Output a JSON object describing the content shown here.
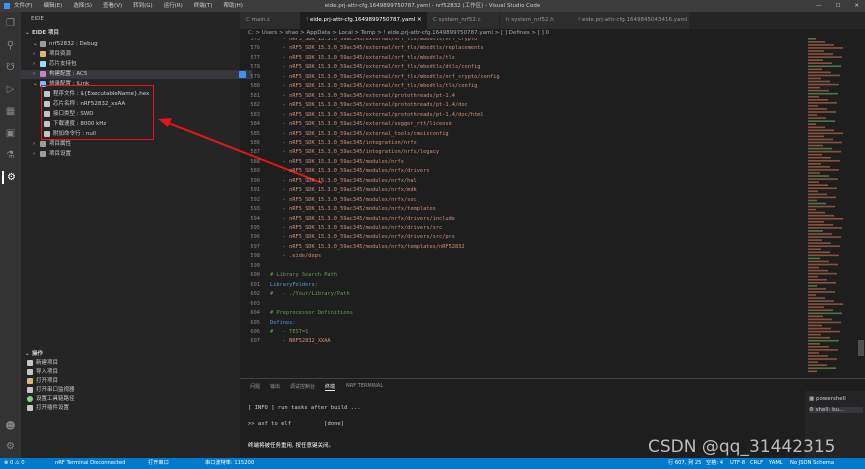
{
  "titlebar": {
    "menus": [
      "文件(F)",
      "编辑(E)",
      "选择(S)",
      "查看(V)",
      "转到(G)",
      "运行(R)",
      "终端(T)",
      "帮助(H)"
    ],
    "title": "eide.prj-attr-cfg.1649899750787.yaml - nrf52832 (工作区) - Visual Studio Code"
  },
  "sidebar": {
    "header": "EIDE",
    "section": "EIDE 项目",
    "project": "nrf52832 : Debug",
    "items": [
      "项目资源",
      "芯片支持包",
      "构建配置 : AC5",
      "烧录配置 : JLink"
    ],
    "flash": [
      "程序文件 : ${ExecutableName}.hex",
      "芯片名称 : nRF52832_xxAA",
      "接口类型 : SWD",
      "下载速度 : 8000 kHz",
      "附加命令行 : null"
    ],
    "after": [
      "项目属性",
      "项目设置"
    ],
    "ops_header": "操作",
    "ops": [
      "新建项目",
      "导入项目",
      "打开项目",
      "打开串口监视器",
      "设置工具链路径",
      "打开插件设置"
    ]
  },
  "tabs": [
    "main.c",
    "eide.prj-attr-cfg.1649899750787.yaml",
    "system_nrf52.c",
    "system_nrf52.h",
    "eide.prj-attr-cfg.1649845043416.yaml"
  ],
  "breadcrumb": "C: > Users > shao > AppData > Local > Temp > ! eide.prj-attr-cfg.1649899750787.yaml > [ ] Defines > [ ] 0",
  "code": [
    {
      "n": "575",
      "t": "    - nRF5_SDK_15.3.0_59ac345/external/nrf_tls/mbedtls/nrf_crypto"
    },
    {
      "n": "576",
      "t": "    - nRF5_SDK_15.3.0_59ac345/external/nrf_tls/mbedtls/replacements"
    },
    {
      "n": "577",
      "t": "    - nRF5_SDK_15.3.0_59ac345/external/nrf_tls/mbedtls/tls"
    },
    {
      "n": "578",
      "t": "    - nRF5_SDK_15.3.0_59ac345/external/nrf_tls/mbedtls/dtls/config"
    },
    {
      "n": "579",
      "t": "    - nRF5_SDK_15.3.0_59ac345/external/nrf_tls/mbedtls/nrf_crypto/config"
    },
    {
      "n": "580",
      "t": "    - nRF5_SDK_15.3.0_59ac345/external/nrf_tls/mbedtls/tls/config"
    },
    {
      "n": "581",
      "t": "    - nRF5_SDK_15.3.0_59ac345/external/protothreads/pt-1.4"
    },
    {
      "n": "582",
      "t": "    - nRF5_SDK_15.3.0_59ac345/external/protothreads/pt-1.4/doc"
    },
    {
      "n": "583",
      "t": "    - nRF5_SDK_15.3.0_59ac345/external/protothreads/pt-1.4/doc/html"
    },
    {
      "n": "584",
      "t": "    - nRF5_SDK_15.3.0_59ac345/external/segger_rtt/license"
    },
    {
      "n": "585",
      "t": "    - nRF5_SDK_15.3.0_59ac345/external_tools/cmsisconfig"
    },
    {
      "n": "586",
      "t": "    - nRF5_SDK_15.3.0_59ac345/integration/nrfx"
    },
    {
      "n": "587",
      "t": "    - nRF5_SDK_15.3.0_59ac345/integration/nrfx/legacy"
    },
    {
      "n": "588",
      "t": "    - nRF5_SDK_15.3.0_59ac345/modules/nrfx"
    },
    {
      "n": "589",
      "t": "    - nRF5_SDK_15.3.0_59ac345/modules/nrfx/drivers"
    },
    {
      "n": "590",
      "t": "    - nRF5_SDK_15.3.0_59ac345/modules/nrfx/hal"
    },
    {
      "n": "591",
      "t": "    - nRF5_SDK_15.3.0_59ac345/modules/nrfx/mdk"
    },
    {
      "n": "592",
      "t": "    - nRF5_SDK_15.3.0_59ac345/modules/nrfx/soc"
    },
    {
      "n": "593",
      "t": "    - nRF5_SDK_15.3.0_59ac345/modules/nrfx/templates"
    },
    {
      "n": "594",
      "t": "    - nRF5_SDK_15.3.0_59ac345/modules/nrfx/drivers/include"
    },
    {
      "n": "595",
      "t": "    - nRF5_SDK_15.3.0_59ac345/modules/nrfx/drivers/src"
    },
    {
      "n": "596",
      "t": "    - nRF5_SDK_15.3.0_59ac345/modules/nrfx/drivers/src/prs"
    },
    {
      "n": "597",
      "t": "    - nRF5_SDK_15.3.0_59ac345/modules/nrfx/templates/nRF52832"
    },
    {
      "n": "598",
      "t": "    - .eide/deps"
    },
    {
      "n": "599",
      "t": ""
    },
    {
      "n": "600",
      "t": "# Library Search Path"
    },
    {
      "n": "601",
      "t": "LibraryFolders:"
    },
    {
      "n": "602",
      "t": "#   - ./Your/Library/Path"
    },
    {
      "n": "603",
      "t": ""
    },
    {
      "n": "604",
      "t": "# Preprocessor Definitions"
    },
    {
      "n": "605",
      "t": "Defines:"
    },
    {
      "n": "606",
      "t": "#   - TEST=1"
    },
    {
      "n": "607",
      "t": "    - NRF52832_XXAA"
    }
  ],
  "panel": {
    "tabs": [
      "问题",
      "输出",
      "调试控制台",
      "终端",
      "NRF TERMINAL"
    ],
    "lines": [
      "[ INFO ] run tasks after build ...",
      ">> axf to elf          [done]",
      "终端将被任务重用, 按任意键关闭。"
    ],
    "terminals": [
      "powershell",
      "shell: bu..."
    ]
  },
  "status": {
    "left": [
      "⊗ 0 ⚠ 0",
      "nRF Terminal Disconnected",
      "打开串口",
      "串口波特率: 115200"
    ],
    "right": [
      "行 607, 列 25",
      "空格: 4",
      "UTF-8",
      "CRLF",
      "YAML",
      "No JSON Schema"
    ]
  },
  "watermark": "CSDN @qq_31442315",
  "colors": {
    "accent": "#007acc",
    "annotation": "#e4141b",
    "string": "#ce9178",
    "comment": "#6a9955",
    "key": "#569cd6"
  }
}
